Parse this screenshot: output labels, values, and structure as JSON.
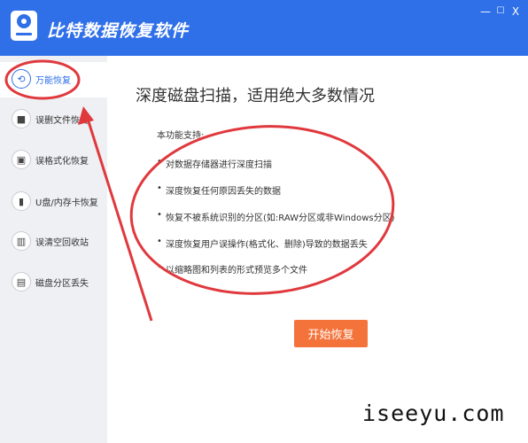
{
  "window": {
    "app_title": "比特数据恢复软件",
    "minimize_glyph": "—",
    "maximize_glyph": "☐",
    "close_glyph": "X"
  },
  "sidebar": {
    "items": [
      {
        "label": "万能恢复",
        "icon": "refresh-icon",
        "glyph": "⟲",
        "active": true
      },
      {
        "label": "误删文件恢复",
        "icon": "folder-icon",
        "glyph": "■",
        "active": false
      },
      {
        "label": "误格式化恢复",
        "icon": "disk-icon",
        "glyph": "▣",
        "active": false
      },
      {
        "label": "U盘/内存卡恢复",
        "icon": "usb-icon",
        "glyph": "▮",
        "active": false
      },
      {
        "label": "误清空回收站",
        "icon": "trash-icon",
        "glyph": "▥",
        "active": false
      },
      {
        "label": "磁盘分区丢失",
        "icon": "partition-icon",
        "glyph": "▤",
        "active": false
      }
    ]
  },
  "main": {
    "title": "深度磁盘扫描，适用绝大多数情况",
    "features_heading": "本功能支持:",
    "features": [
      "对数据存储器进行深度扫描",
      "深度恢复任何原因丢失的数据",
      "恢复不被系统识别的分区(如:RAW分区或非Windows分区)",
      "深度恢复用户误操作(格式化、删除)导致的数据丢失",
      "以缩略图和列表的形式预览多个文件"
    ],
    "start_button": "开始恢复"
  },
  "watermark": "iseeyu.com",
  "colors": {
    "header_blue": "#2f6fe8",
    "accent_orange": "#f4733a",
    "annotation_red": "#e0393d",
    "sidebar_bg": "#eef0f3"
  }
}
